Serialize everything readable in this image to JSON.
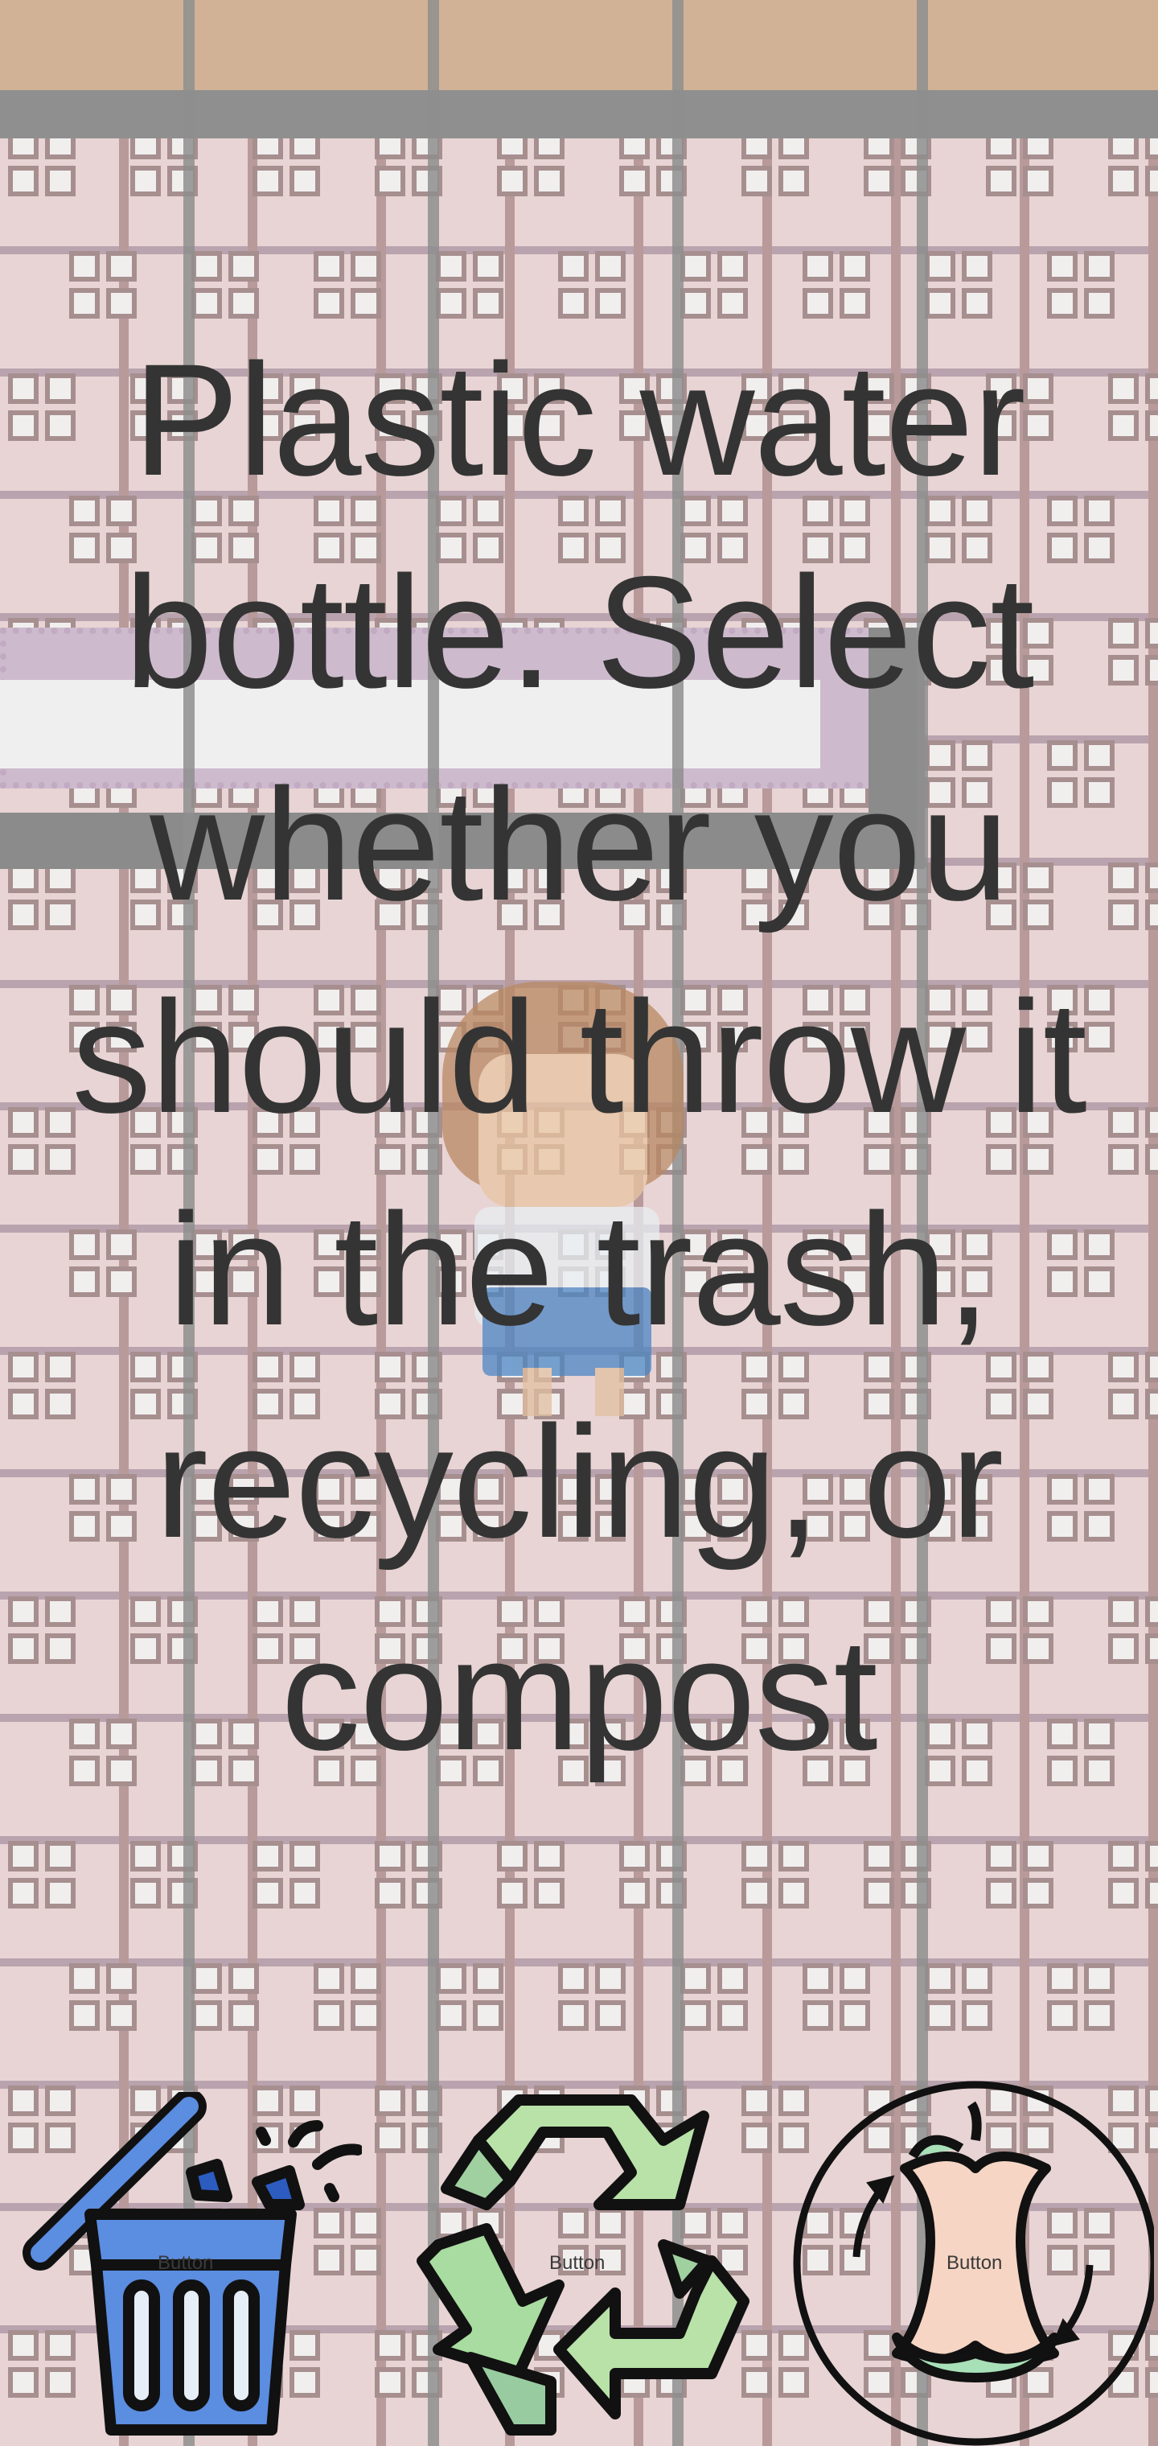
{
  "prompt": {
    "text": "Plastic water bottle. Select whether you should throw it in the trash, recycling, or compost"
  },
  "choices": [
    {
      "label": "Button",
      "icon": "trash-can-icon"
    },
    {
      "label": "Button",
      "icon": "recycle-icon"
    },
    {
      "label": "Button",
      "icon": "compost-icon"
    }
  ],
  "colors": {
    "text": "#343434",
    "floor": "#e8d4d4",
    "wall": "#d1b296",
    "trash_blue": "#5b8de0",
    "recycle_green": "#a8dca0",
    "compost_peach": "#f6d5c4"
  }
}
